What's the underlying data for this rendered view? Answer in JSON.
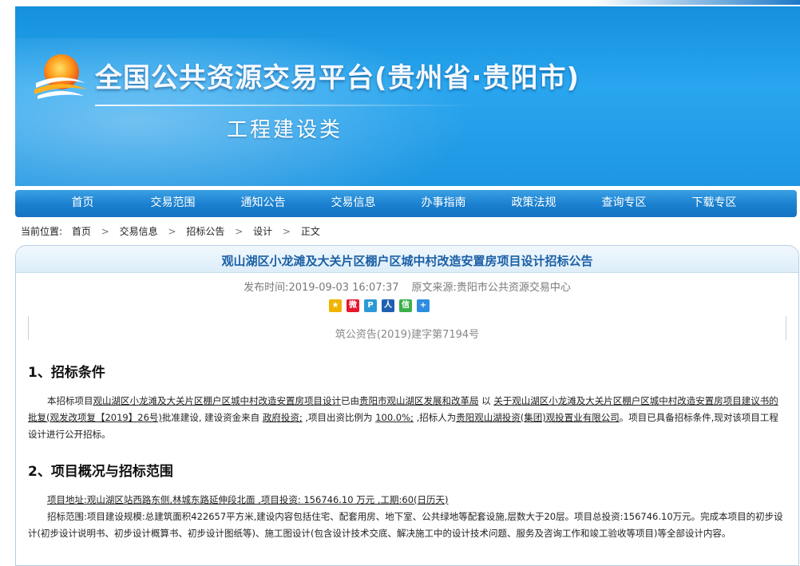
{
  "banner": {
    "title": "全国公共资源交易平台(贵州省·贵阳市)",
    "subtitle": "工程建设类"
  },
  "nav": {
    "items": [
      "首页",
      "交易范围",
      "通知公告",
      "交易信息",
      "办事指南",
      "政策法规",
      "查询专区",
      "下载专区"
    ]
  },
  "breadcrumb": {
    "label": "当前位置:",
    "items": [
      "首页",
      "交易信息",
      "招标公告",
      "设计",
      "正文"
    ],
    "separator": ">"
  },
  "article": {
    "title": "观山湖区小龙滩及大关片区棚户区城中村改造安置房项目设计招标公告",
    "publish_label": "发布时间:",
    "publish_time": "2019-09-03 16:07:37",
    "source_label": "原文来源:",
    "source": "贵阳市公共资源交易中心",
    "doc_number": "筑公资告(2019)建字第7194号"
  },
  "share_icons": [
    {
      "name": "qzone-icon",
      "glyph": "★",
      "color": "#f0b400"
    },
    {
      "name": "weibo-icon",
      "glyph": "微",
      "color": "#e6162d"
    },
    {
      "name": "tencent-weibo-icon",
      "glyph": "P",
      "color": "#2b9ad6"
    },
    {
      "name": "renren-icon",
      "glyph": "人",
      "color": "#1f5fb0"
    },
    {
      "name": "wechat-icon",
      "glyph": "信",
      "color": "#3bb04a"
    },
    {
      "name": "more-share-icon",
      "glyph": "+",
      "color": "#2e8de0"
    }
  ],
  "section1": {
    "heading": "1、招标条件",
    "t1": "本招标项目",
    "u1": "观山湖区小龙滩及大关片区棚户区城中村改造安置房项目设计",
    "t2": "已由",
    "u2": "贵阳市观山湖区发展和改革局",
    "t3": " 以 ",
    "u3": "关于观山湖区小龙滩及大关片区棚户区城中村改造安置房项目建议书的批复(观发改项复【2019】26号)",
    "t4": "批准建设, 建设资金来自 ",
    "u4": "政府投资;",
    "t5": " ,项目出资比例为 ",
    "u5": "100.0%;",
    "t6": " ,招标人为",
    "u6": "贵阳观山湖投资(集团)观投置业有限公司",
    "t7": "。项目已具备招标条件,现对该项目工程设计进行公开招标。"
  },
  "section2": {
    "heading": "2、项目概况与招标范围",
    "line1": "项目地址:观山湖区站西路东侧,林城东路延伸段北面 ,项目投资: 156746.10 万元 ,工期:60(日历天)",
    "line2": "招标范围:项目建设规模:总建筑面积422657平方米,建设内容包括住宅、配套用房、地下室、公共绿地等配套设施,层数大于20层。项目总投资:156746.10万元。完成本项目的初步设计(初步设计说明书、初步设计概算书、初步设计图纸等)、施工图设计(包含设计技术交底、解决施工中的设计技术问题、服务及咨询工作和竣工验收等项目)等全部设计内容。"
  }
}
